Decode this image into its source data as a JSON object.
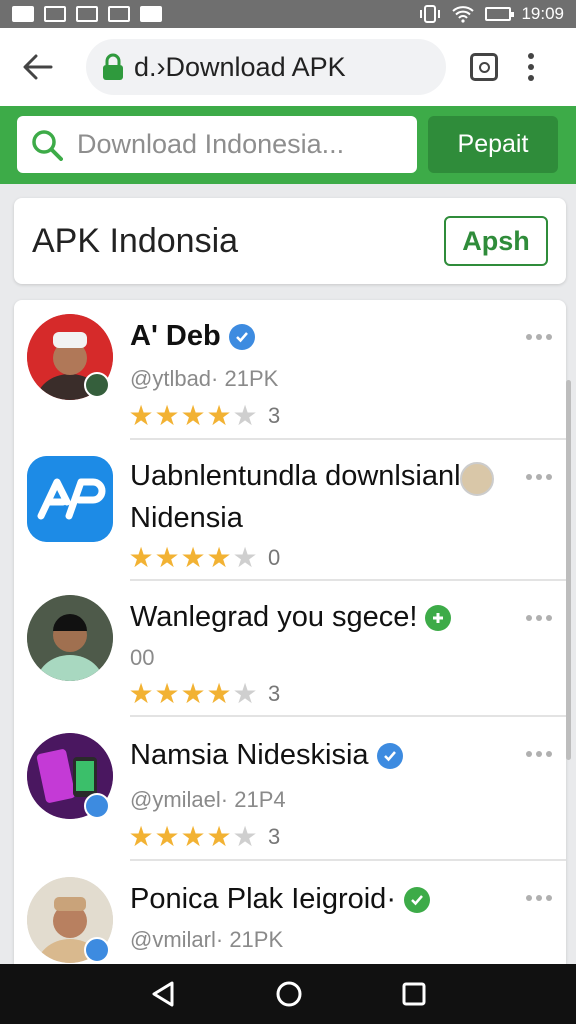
{
  "status_bar": {
    "time": "19:09"
  },
  "browser": {
    "url": "d.›Download APK",
    "colors": {
      "accent": "#3dab48",
      "accent_dark": "#2f8c3a"
    }
  },
  "search": {
    "placeholder": "Download Indonesia...",
    "button_label": "Pepait"
  },
  "header": {
    "title": "APK Indonsia",
    "button_label": "Apsh"
  },
  "apps": [
    {
      "name": "A' Deb",
      "sub": "@ytlbad· 21PK",
      "rating": 4,
      "count": "3",
      "icon": "person-avatar",
      "verified": "blue"
    },
    {
      "name": "Uabnlentundla downlsianl",
      "name2": "Nidensia",
      "rating": 4,
      "count": "0",
      "icon": "apk-app-icon"
    },
    {
      "name": "Wanlegrad you sgece!",
      "sub": "00",
      "rating": 4,
      "count": "3",
      "icon": "person-avatar",
      "verified": "green"
    },
    {
      "name": "Namsia  Nideskisia",
      "sub": "@ymilael· 21P4",
      "rating": 4,
      "count": "3",
      "icon": "phone-avatar",
      "verified": "blue"
    },
    {
      "name": "Ponica Plak Ieigroid·",
      "sub": "@vmilarl· 21PK",
      "icon": "person-avatar",
      "verified": "green"
    }
  ]
}
